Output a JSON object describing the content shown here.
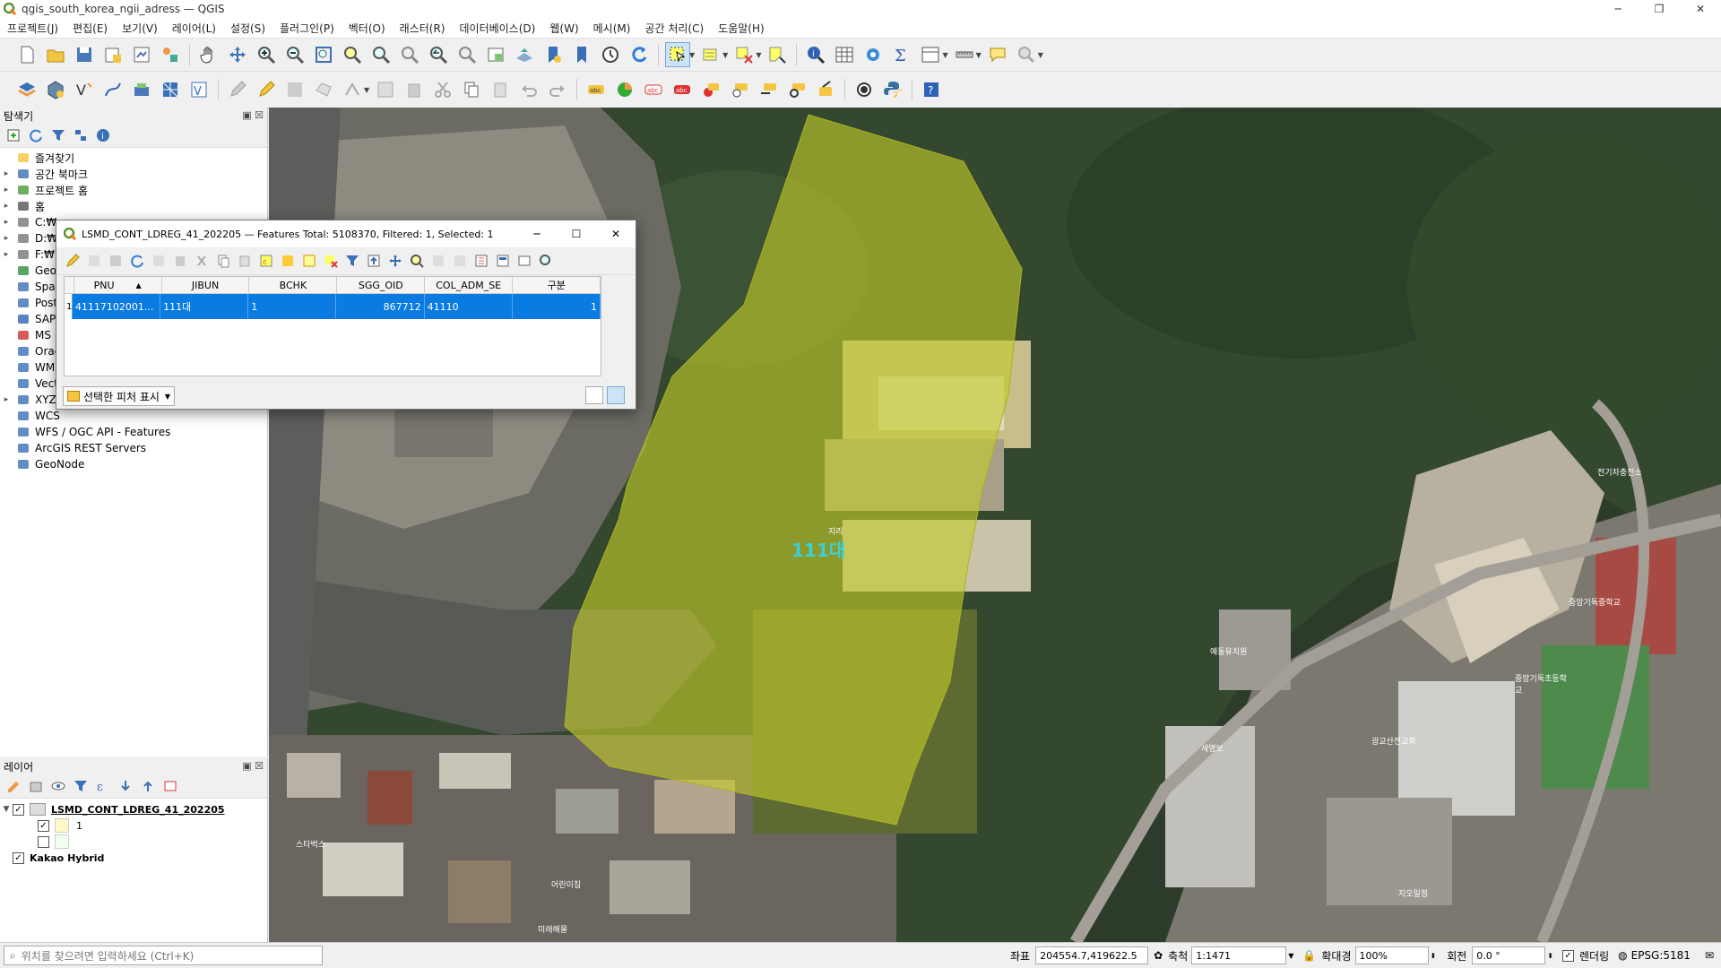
{
  "window": {
    "title": "qgis_south_korea_ngii_adress — QGIS",
    "minimize": "─",
    "restore": "❐",
    "close": "✕"
  },
  "menu": [
    "프로젝트(J)",
    "편집(E)",
    "보기(V)",
    "레이어(L)",
    "설정(S)",
    "플러그인(P)",
    "벡터(O)",
    "래스터(R)",
    "데이터베이스(D)",
    "웹(W)",
    "메시(M)",
    "공간 처리(C)",
    "도움말(H)"
  ],
  "browser_panel": {
    "title": "탐색기",
    "items": [
      {
        "label": "즐겨찾기",
        "icon": "star-icon",
        "expandable": false
      },
      {
        "label": "공간 북마크",
        "icon": "bookmark-icon",
        "expandable": true
      },
      {
        "label": "프로젝트 홈",
        "icon": "project-home-icon",
        "expandable": true
      },
      {
        "label": "홈",
        "icon": "home-folder-icon",
        "expandable": true
      },
      {
        "label": "C:₩",
        "icon": "drive-icon",
        "expandable": true
      },
      {
        "label": "D:₩",
        "icon": "drive-icon",
        "expandable": true
      },
      {
        "label": "F:₩",
        "icon": "drive-icon",
        "expandable": true
      },
      {
        "label": "Geo",
        "icon": "geopackage-icon",
        "expandable": false
      },
      {
        "label": "Spat",
        "icon": "spatialite-icon",
        "expandable": false
      },
      {
        "label": "Post",
        "icon": "postgis-icon",
        "expandable": false
      },
      {
        "label": "SAP",
        "icon": "sap-hana-icon",
        "expandable": false
      },
      {
        "label": "MS",
        "icon": "mssql-icon",
        "expandable": false
      },
      {
        "label": "Orac",
        "icon": "oracle-icon",
        "expandable": false
      },
      {
        "label": "WM",
        "icon": "wms-icon",
        "expandable": false
      },
      {
        "label": "Vect",
        "icon": "vector-tile-icon",
        "expandable": false
      },
      {
        "label": "XYZ",
        "icon": "xyz-tiles-icon",
        "expandable": true
      },
      {
        "label": "WCS",
        "icon": "wcs-icon",
        "expandable": false
      },
      {
        "label": "WFS / OGC API - Features",
        "icon": "wfs-icon",
        "expandable": false
      },
      {
        "label": "ArcGIS REST Servers",
        "icon": "arcgis-rest-icon",
        "expandable": false
      },
      {
        "label": "GeoNode",
        "icon": "geonode-icon",
        "expandable": false
      }
    ]
  },
  "layers_panel": {
    "title": "레이어",
    "layer1": "LSMD_CONT_LDREG_41_202205",
    "cat1": "1",
    "cat2": "",
    "layer2": "Kakao Hybrid"
  },
  "attribute_table": {
    "title": "LSMD_CONT_LDREG_41_202205 — Features Total: 5108370, Filtered: 1, Selected: 1",
    "columns": [
      "PNU",
      "JIBUN",
      "BCHK",
      "SGG_OID",
      "COL_ADM_SE",
      "구분"
    ],
    "row_number": "1",
    "row": [
      "41117102001...",
      "111대",
      "1",
      "867712",
      "41110",
      "1"
    ],
    "show_selected": "선택한 피처 표시"
  },
  "map": {
    "parcel_label": "111대",
    "labels": [
      "지리",
      "전기차충전소",
      "예동유치원",
      "중앙기독중학교",
      "중앙기독초등학교",
      "광교산전교회",
      "스타벅스",
      "세명보",
      "지오일정",
      "미래해물",
      "어린이집"
    ],
    "parcel_color": "#c4cc2a"
  },
  "statusbar": {
    "locator_placeholder": "위치를 찾으려면 입력하세요 (Ctrl+K)",
    "coord_label": "좌표",
    "coord_value": "204554.7,419622.5",
    "scale_label": "축척",
    "scale_value": "1:1471",
    "magnifier_label": "확대경",
    "magnifier_value": "100%",
    "rotation_label": "회전",
    "rotation_value": "0.0 °",
    "render_label": "렌더링",
    "crs": "EPSG:5181"
  }
}
